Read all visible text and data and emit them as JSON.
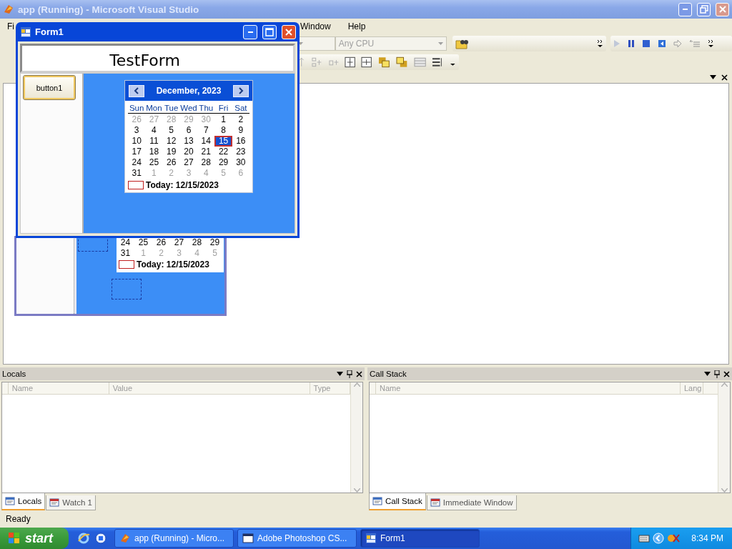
{
  "window": {
    "title": "app (Running) - Microsoft Visual Studio"
  },
  "menu": [
    "Fi",
    "Window",
    "Help"
  ],
  "toolbar": {
    "platform": "Any CPU"
  },
  "designer_form": {
    "weeks": [
      [
        {
          "day": "24",
          "other_month": false
        },
        {
          "day": "25",
          "other_month": false
        },
        {
          "day": "26",
          "other_month": false
        },
        {
          "day": "27",
          "other_month": false
        },
        {
          "day": "28",
          "other_month": false
        },
        {
          "day": "29",
          "other_month": false
        }
      ],
      [
        {
          "day": "31",
          "other_month": false
        },
        {
          "day": "1",
          "other_month": true
        },
        {
          "day": "2",
          "other_month": true
        },
        {
          "day": "3",
          "other_month": true
        },
        {
          "day": "4",
          "other_month": true
        },
        {
          "day": "5",
          "other_month": true
        }
      ]
    ],
    "today": "Today: 12/15/2023"
  },
  "running_form": {
    "title": "Form1",
    "heading": "TestForm",
    "button": "button1",
    "calendar": {
      "month": "December, 2023",
      "weekdays": [
        "Sun",
        "Mon",
        "Tue",
        "Wed",
        "Thu",
        "Fri",
        "Sat"
      ],
      "weeks": [
        [
          {
            "day": "26",
            "other_month": true,
            "selected": false
          },
          {
            "day": "27",
            "other_month": true,
            "selected": false
          },
          {
            "day": "28",
            "other_month": true,
            "selected": false
          },
          {
            "day": "29",
            "other_month": true,
            "selected": false
          },
          {
            "day": "30",
            "other_month": true,
            "selected": false
          },
          {
            "day": "1",
            "other_month": false,
            "selected": false
          },
          {
            "day": "2",
            "other_month": false,
            "selected": false
          }
        ],
        [
          {
            "day": "3",
            "other_month": false,
            "selected": false
          },
          {
            "day": "4",
            "other_month": false,
            "selected": false
          },
          {
            "day": "5",
            "other_month": false,
            "selected": false
          },
          {
            "day": "6",
            "other_month": false,
            "selected": false
          },
          {
            "day": "7",
            "other_month": false,
            "selected": false
          },
          {
            "day": "8",
            "other_month": false,
            "selected": false
          },
          {
            "day": "9",
            "other_month": false,
            "selected": false
          }
        ],
        [
          {
            "day": "10",
            "other_month": false,
            "selected": false
          },
          {
            "day": "11",
            "other_month": false,
            "selected": false
          },
          {
            "day": "12",
            "other_month": false,
            "selected": false
          },
          {
            "day": "13",
            "other_month": false,
            "selected": false
          },
          {
            "day": "14",
            "other_month": false,
            "selected": false
          },
          {
            "day": "15",
            "other_month": false,
            "selected": true
          },
          {
            "day": "16",
            "other_month": false,
            "selected": false
          }
        ],
        [
          {
            "day": "17",
            "other_month": false,
            "selected": false
          },
          {
            "day": "18",
            "other_month": false,
            "selected": false
          },
          {
            "day": "19",
            "other_month": false,
            "selected": false
          },
          {
            "day": "20",
            "other_month": false,
            "selected": false
          },
          {
            "day": "21",
            "other_month": false,
            "selected": false
          },
          {
            "day": "22",
            "other_month": false,
            "selected": false
          },
          {
            "day": "23",
            "other_month": false,
            "selected": false
          }
        ],
        [
          {
            "day": "24",
            "other_month": false,
            "selected": false
          },
          {
            "day": "25",
            "other_month": false,
            "selected": false
          },
          {
            "day": "26",
            "other_month": false,
            "selected": false
          },
          {
            "day": "27",
            "other_month": false,
            "selected": false
          },
          {
            "day": "28",
            "other_month": false,
            "selected": false
          },
          {
            "day": "29",
            "other_month": false,
            "selected": false
          },
          {
            "day": "30",
            "other_month": false,
            "selected": false
          }
        ],
        [
          {
            "day": "31",
            "other_month": false,
            "selected": false
          },
          {
            "day": "1",
            "other_month": true,
            "selected": false
          },
          {
            "day": "2",
            "other_month": true,
            "selected": false
          },
          {
            "day": "3",
            "other_month": true,
            "selected": false
          },
          {
            "day": "4",
            "other_month": true,
            "selected": false
          },
          {
            "day": "5",
            "other_month": true,
            "selected": false
          },
          {
            "day": "6",
            "other_month": true,
            "selected": false
          }
        ]
      ],
      "today": "Today: 12/15/2023"
    }
  },
  "panels": [
    {
      "title": "Locals",
      "columns": [
        "Name",
        "Value",
        "Type"
      ],
      "tabs": [
        {
          "label": "Locals",
          "selected": true
        },
        {
          "label": "Watch 1",
          "selected": false
        }
      ]
    },
    {
      "title": "Call Stack",
      "columns": [
        "Name",
        "Lang"
      ],
      "tabs": [
        {
          "label": "Call Stack",
          "selected": true
        },
        {
          "label": "Immediate Window",
          "selected": false
        }
      ]
    }
  ],
  "status_bar": "Ready",
  "taskbar": {
    "start": "start",
    "tasks": [
      {
        "label": "app (Running) - Micro...",
        "selected": false
      },
      {
        "label": "Adobe Photoshop CS...",
        "selected": false
      },
      {
        "label": "Form1",
        "selected": true
      }
    ],
    "clock": "8:34 PM"
  }
}
